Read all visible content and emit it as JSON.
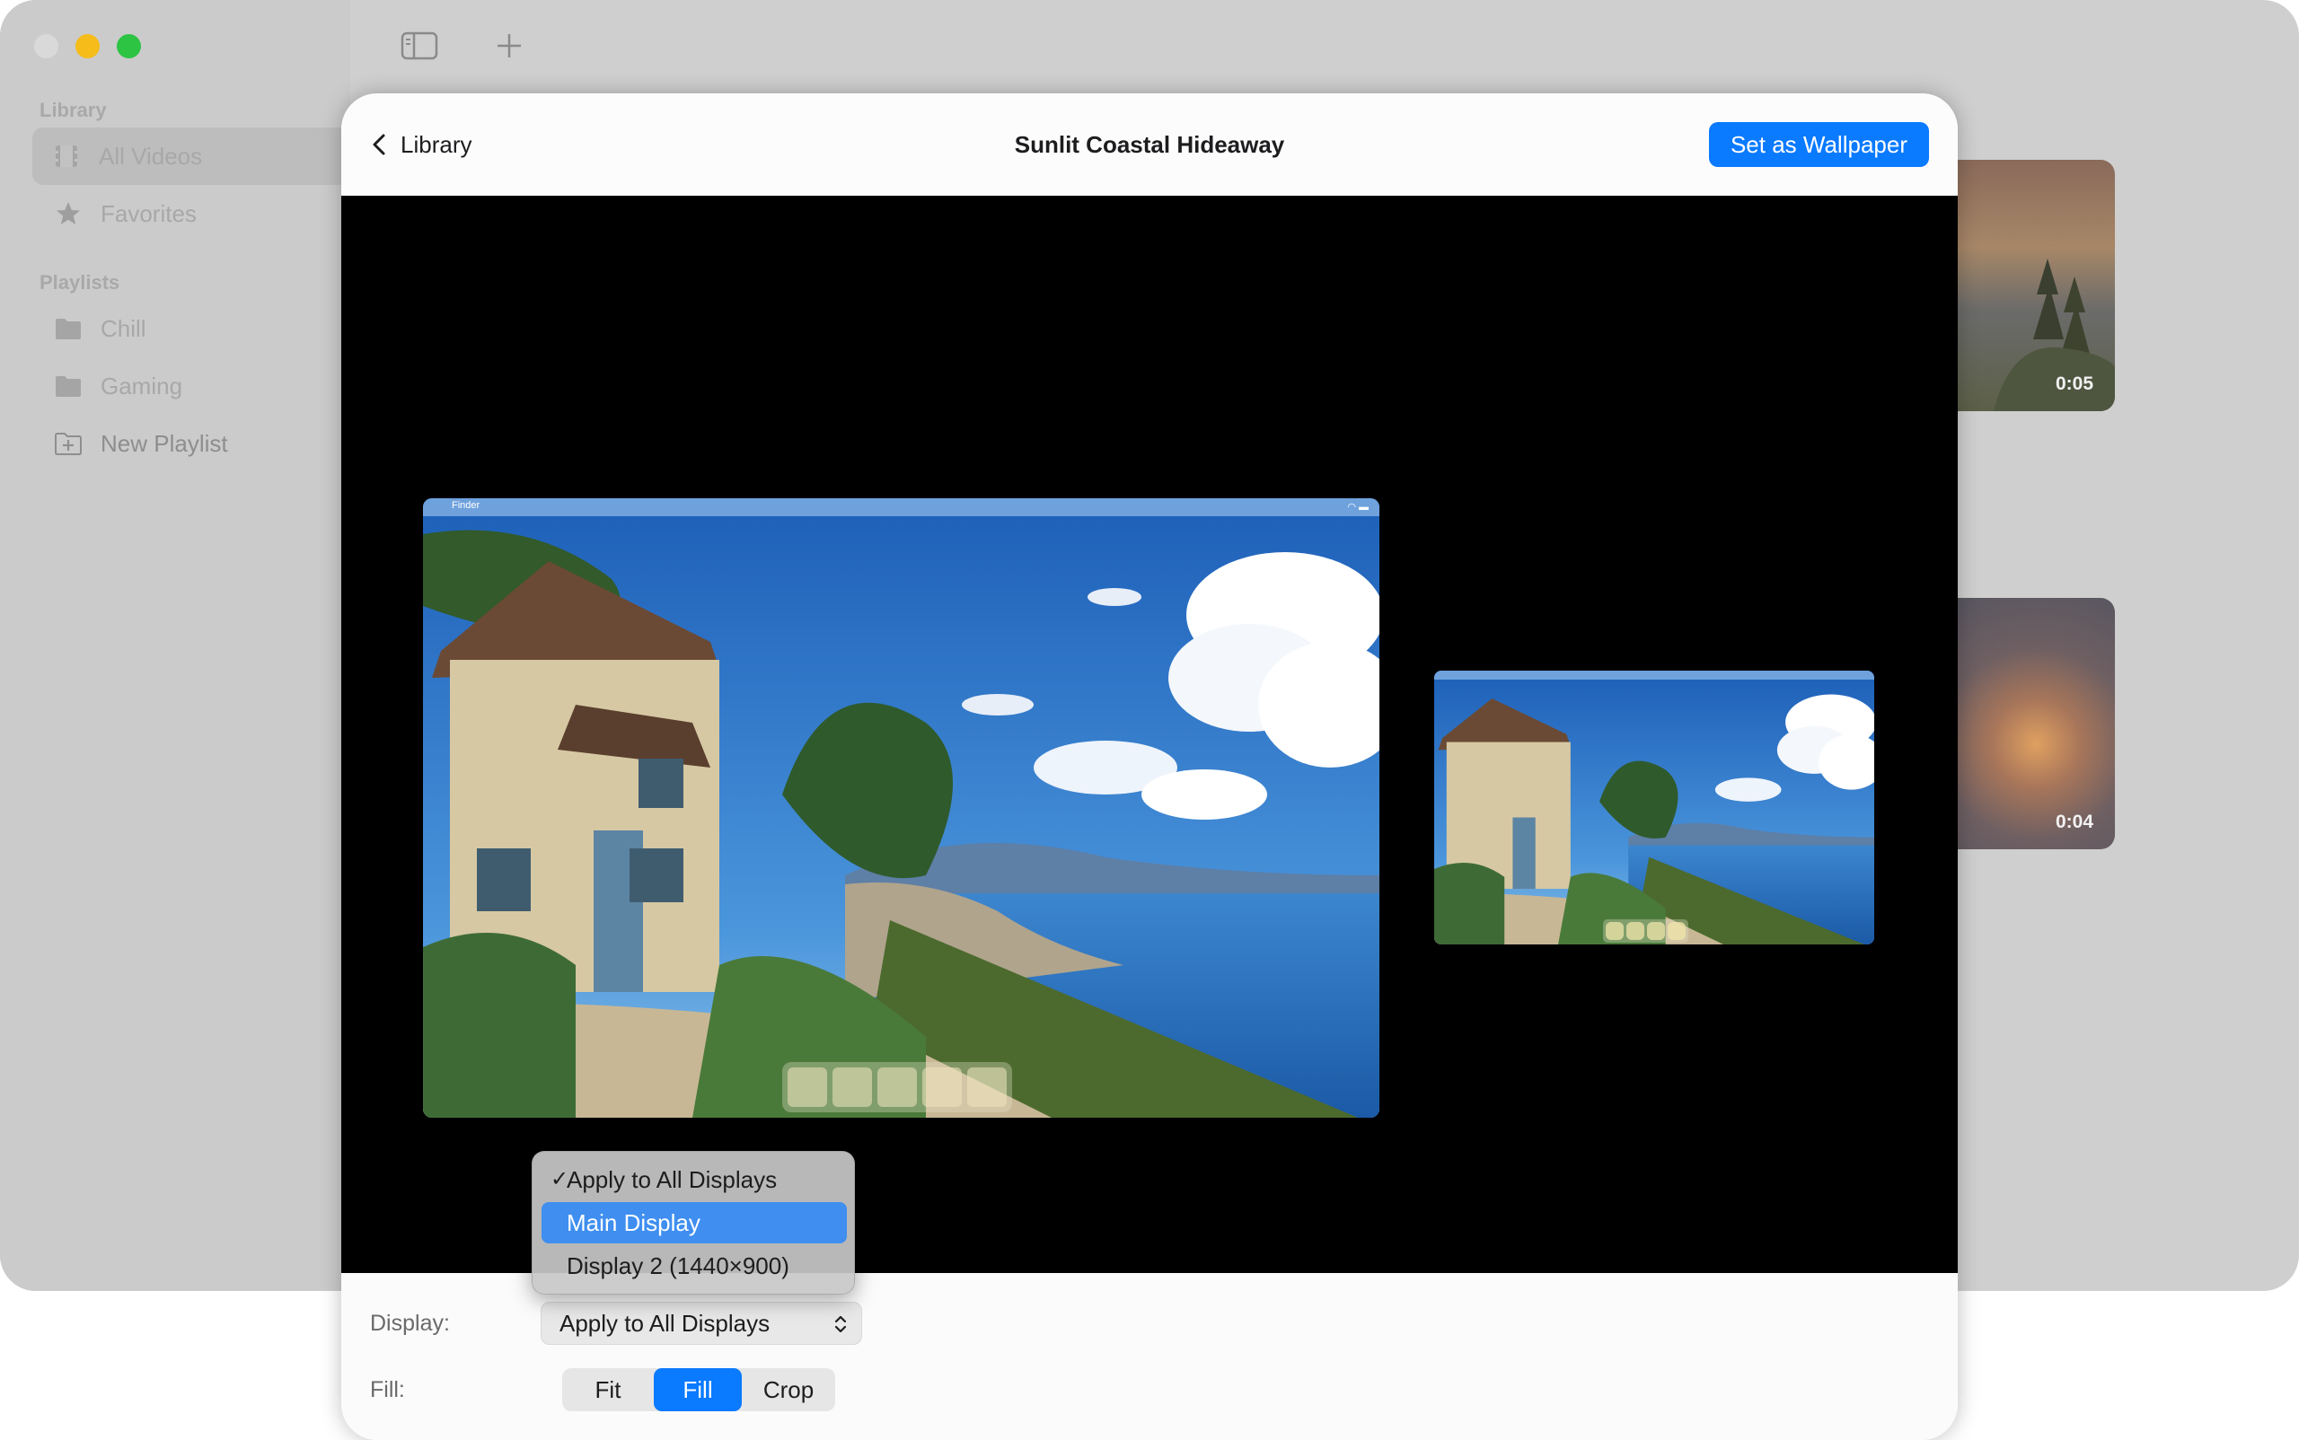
{
  "sidebar": {
    "library_heading": "Library",
    "items": [
      {
        "label": "All Videos",
        "icon": "film-icon"
      },
      {
        "label": "Favorites",
        "icon": "star-icon"
      }
    ],
    "playlists_heading": "Playlists",
    "playlists": [
      {
        "label": "Chill",
        "icon": "folder-icon"
      },
      {
        "label": "Gaming",
        "icon": "folder-icon"
      }
    ],
    "new_playlist_label": "New Playlist"
  },
  "background_thumbnails": [
    {
      "duration": "0:05"
    },
    {
      "duration": "0:04"
    }
  ],
  "sheet": {
    "back_label": "Library",
    "title": "Sunlit Coastal Hideaway",
    "set_wallpaper_label": "Set as Wallpaper"
  },
  "preview": {
    "menubar_app": "Finder"
  },
  "controls": {
    "display_label": "Display:",
    "display_value": "Apply to All Displays",
    "fill_label": "Fill:",
    "fill_options": [
      "Fit",
      "Fill",
      "Crop"
    ],
    "fill_selected": "Fill"
  },
  "display_menu": {
    "items": [
      "Apply to All Displays",
      "Main Display",
      "Display 2 (1440×900)"
    ],
    "checked": "Apply to All Displays",
    "highlighted": "Main Display",
    "check_glyph": "✓"
  },
  "colors": {
    "accent": "#0a7aff",
    "menu_highlight": "#3f8ef0"
  }
}
